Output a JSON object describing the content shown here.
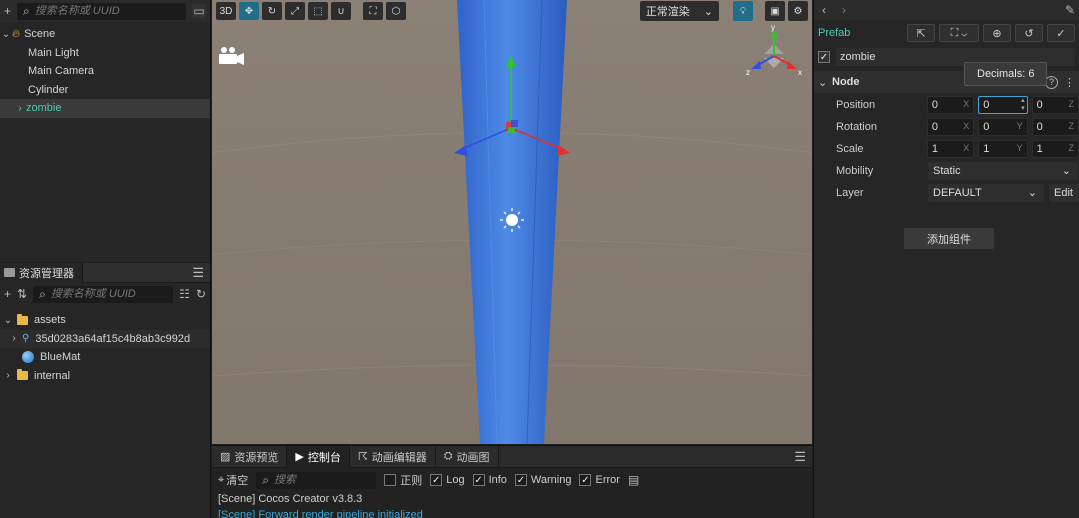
{
  "hierarchy": {
    "search_placeholder": "搜索名称或 UUID",
    "items": [
      {
        "label": "Scene",
        "depth": 0,
        "expanded": true
      },
      {
        "label": "Main Light",
        "depth": 1
      },
      {
        "label": "Main Camera",
        "depth": 1
      },
      {
        "label": "Cylinder",
        "depth": 1
      },
      {
        "label": "zombie",
        "depth": 1,
        "selected": true,
        "collapsed": true
      }
    ]
  },
  "assets": {
    "title": "资源管理器",
    "search_placeholder": "搜索名称或 UUID",
    "items": [
      {
        "label": "assets",
        "type": "folder"
      },
      {
        "label": "35d0283a64af15c4b8ab3c992d",
        "type": "prefab"
      },
      {
        "label": "BlueMat",
        "type": "material"
      },
      {
        "label": "internal",
        "type": "folder"
      }
    ]
  },
  "scene": {
    "mode_3d": "3D",
    "render_mode": "正常渲染",
    "colors": {
      "ground": "#877c72",
      "cylinder": "#3f7ad9",
      "axis_x": "#e03030",
      "axis_y": "#2fc52f",
      "axis_z": "#2f4fe0"
    }
  },
  "console": {
    "tabs": [
      "资源预览",
      "控制台",
      "动画编辑器",
      "动画图"
    ],
    "active_tab": 1,
    "clear_label": "清空",
    "search_placeholder": "搜索",
    "regex_label": "正则",
    "filters": {
      "log": "Log",
      "info": "Info",
      "warning": "Warning",
      "error": "Error"
    },
    "logs": [
      "[Scene] Cocos Creator v3.8.3",
      "[Scene] Forward render pipeline initialized"
    ]
  },
  "inspector": {
    "prefab_label": "Prefab",
    "node_name": "zombie",
    "section_title": "Node",
    "tooltip": "Decimals: 6",
    "add_component": "添加组件",
    "position": {
      "label": "Position",
      "x": "0",
      "y": "0",
      "z": "0"
    },
    "rotation": {
      "label": "Rotation",
      "x": "0",
      "y": "0",
      "z": "0"
    },
    "scale": {
      "label": "Scale",
      "x": "1",
      "y": "1",
      "z": "1"
    },
    "mobility": {
      "label": "Mobility",
      "value": "Static"
    },
    "layer": {
      "label": "Layer",
      "value": "DEFAULT",
      "edit": "Edit"
    },
    "axes": {
      "x": "X",
      "y": "Y",
      "z": "Z"
    }
  }
}
